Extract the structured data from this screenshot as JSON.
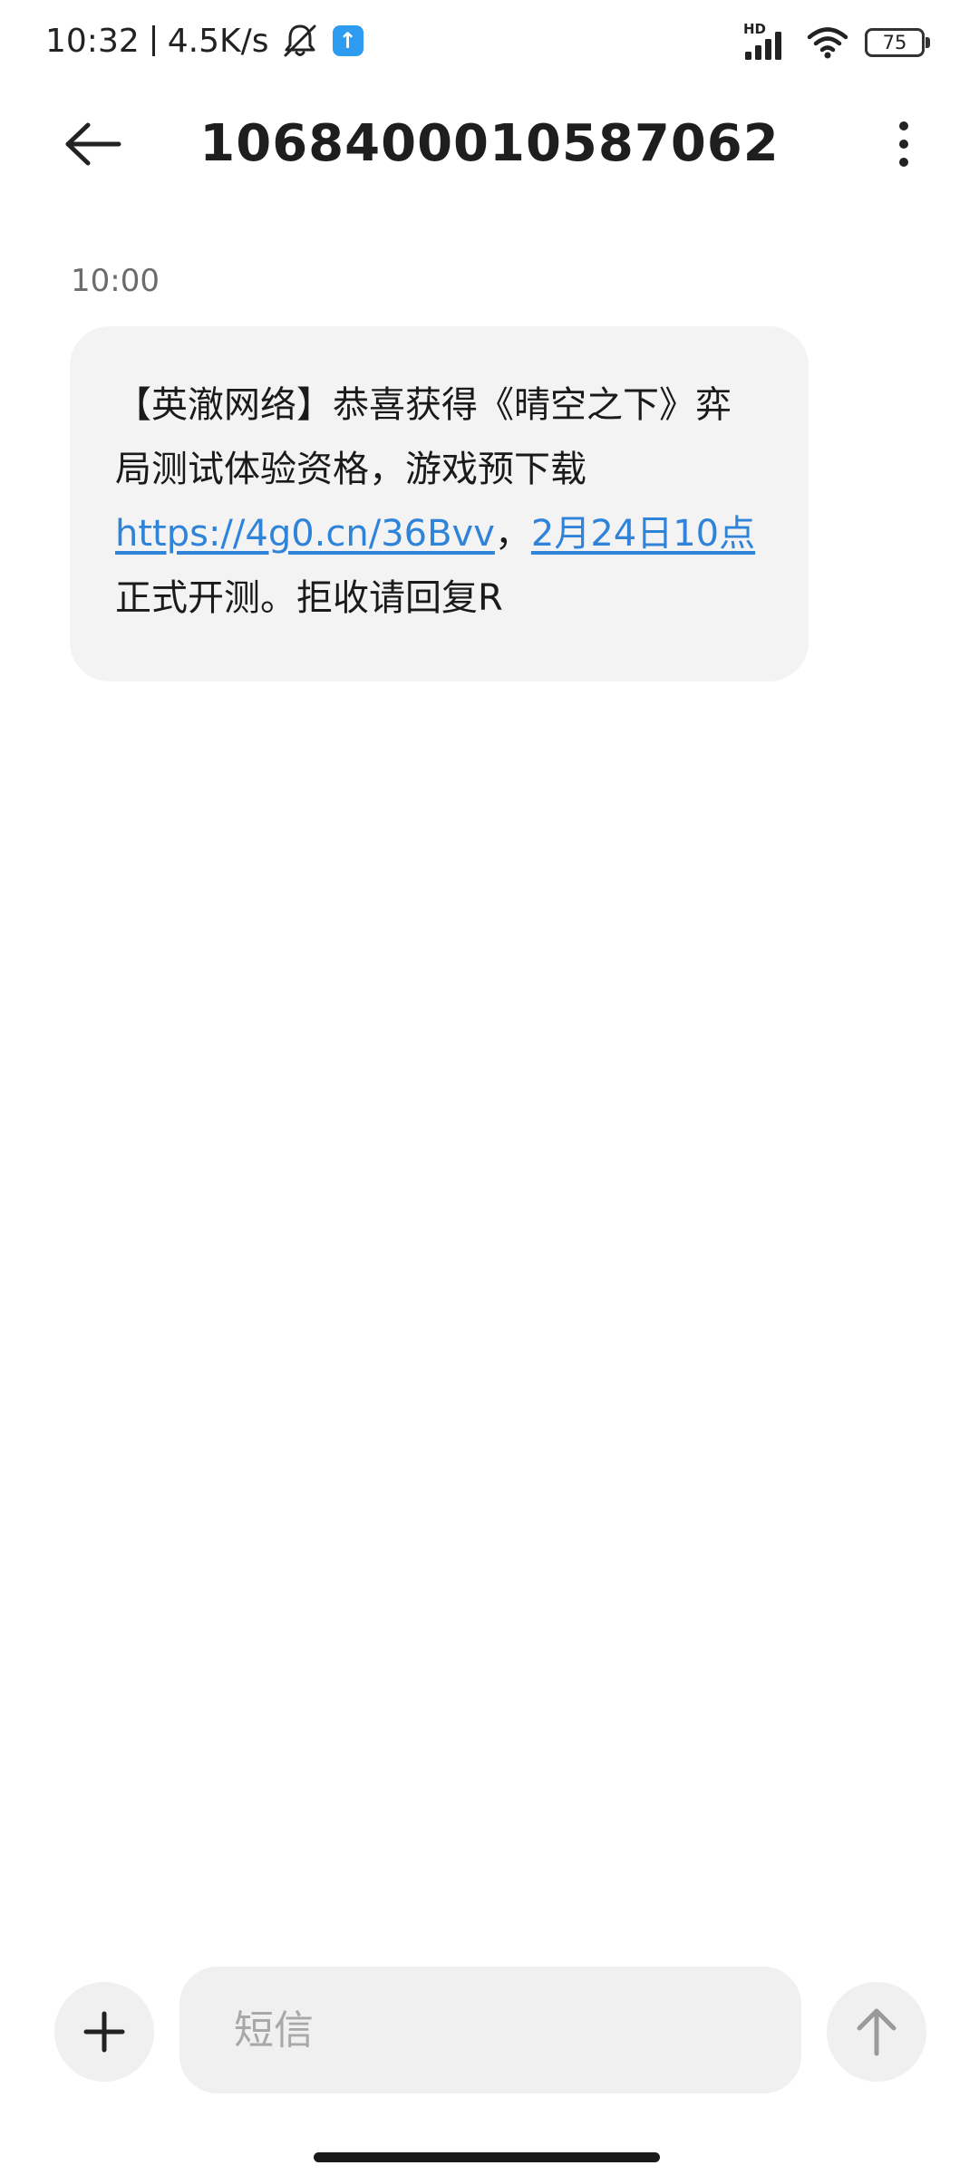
{
  "status_bar": {
    "time": "10:32",
    "net_speed": "4.5K/s",
    "signal_label": "HD",
    "battery_level": "75",
    "icons": [
      "bell-muted-icon",
      "upload-icon",
      "signal-icon",
      "wifi-icon",
      "battery-icon"
    ]
  },
  "header": {
    "title": "1068400010587062",
    "back_icon": "arrow-left-icon",
    "menu_icon": "more-vertical-icon"
  },
  "thread": {
    "timestamp": "10:00",
    "message": {
      "part1": "【英澈网络】恭喜获得《晴空之下》弈局测试体验资格，游戏预下载",
      "link_url": "https://4g0.cn/36Bvv",
      "comma": "，",
      "link_date": "2月24日10点",
      "part2": "正式开测。拒收请回复R"
    }
  },
  "input_bar": {
    "placeholder": "短信",
    "add_icon": "plus-icon",
    "send_icon": "arrow-up-icon"
  },
  "colors": {
    "link": "#2f83d8",
    "bubble_bg": "#f3f3f3",
    "upload_badge": "#2d9cf0"
  }
}
